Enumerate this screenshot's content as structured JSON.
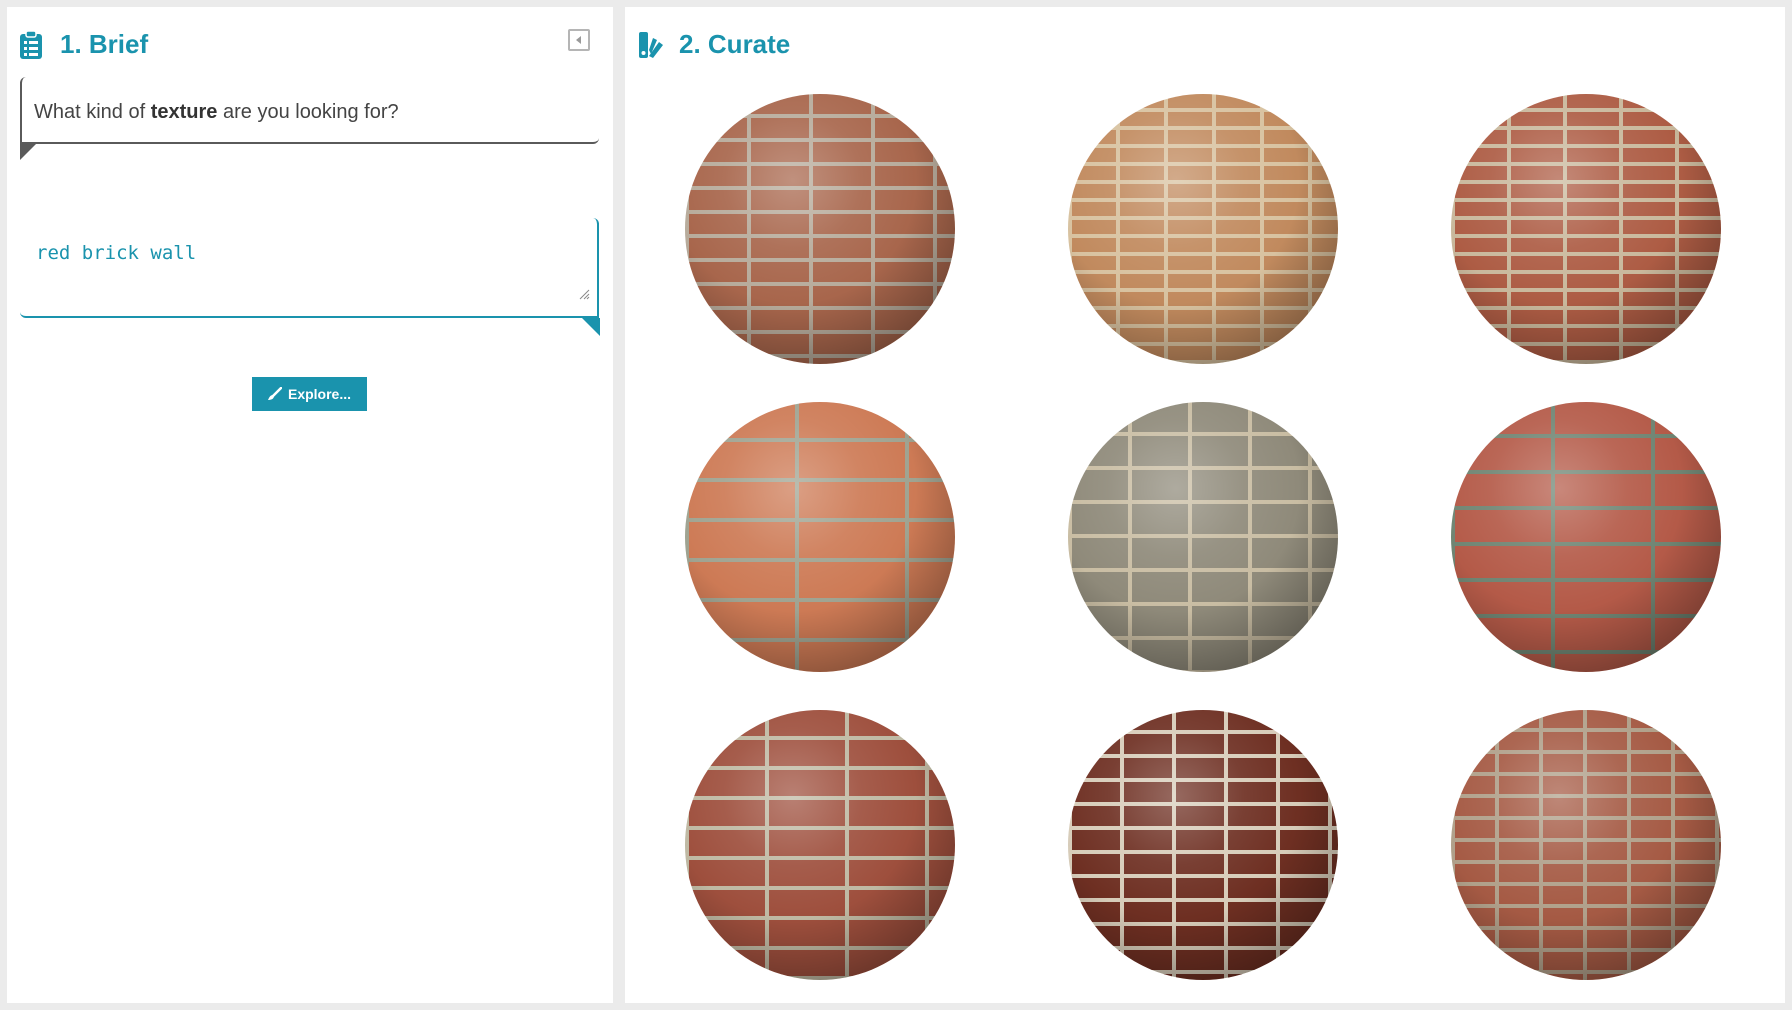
{
  "brief": {
    "title": "1. Brief",
    "prompt_prefix": "What kind of ",
    "prompt_bold": "texture",
    "prompt_suffix": " are you looking for?",
    "query_value": "red brick wall",
    "explore_label": "Explore..."
  },
  "curate": {
    "title": "2. Curate",
    "textures": [
      {
        "brick": "#a8664c",
        "mortar": "#b7ab9b",
        "bh": 24,
        "bw": 62
      },
      {
        "brick": "#c18a5e",
        "mortar": "#d8c2a0",
        "bh": 18,
        "bw": 48
      },
      {
        "brick": "#ad5c44",
        "mortar": "#c9b89c",
        "bh": 18,
        "bw": 56
      },
      {
        "brick": "#cd7a55",
        "mortar": "#9fa391",
        "bh": 40,
        "bw": 110
      },
      {
        "brick": "#8f8a7a",
        "mortar": "#c9bda3",
        "bh": 34,
        "bw": 60
      },
      {
        "brick": "#b45a48",
        "mortar": "#6f8472",
        "bh": 36,
        "bw": 100
      },
      {
        "brick": "#9e4f3d",
        "mortar": "#bfb9a3",
        "bh": 30,
        "bw": 80
      },
      {
        "brick": "#6e2f22",
        "mortar": "#d7ccb9",
        "bh": 24,
        "bw": 52
      },
      {
        "brick": "#a55a44",
        "mortar": "#b0a08a",
        "bh": 22,
        "bw": 44
      }
    ]
  }
}
